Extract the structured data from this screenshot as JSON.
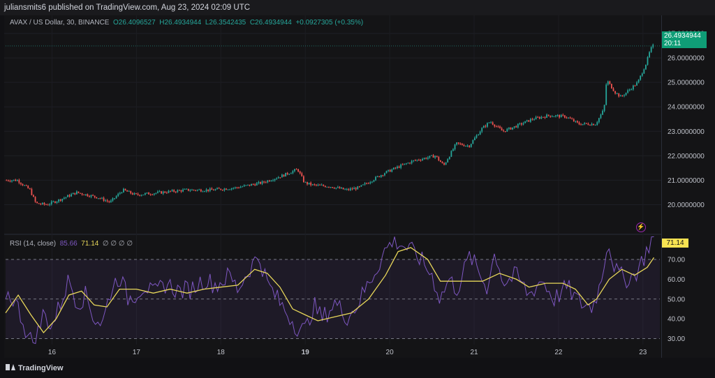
{
  "header": {
    "published": "juliansmits6 published on TradingView.com, Aug 23, 2024 02:09 UTC"
  },
  "legend": {
    "symbol": "AVAX / US Dollar, 30, BINANCE",
    "open": "O26.4096527",
    "high": "H26.4934944",
    "low": "L26.3542435",
    "close": "C26.4934944",
    "change": "+0.0927305 (+0.35%)"
  },
  "rsi_legend": {
    "label": "RSI (14, close)",
    "rsi_value": "85.66",
    "ma_value": "71.14",
    "extra": "∅ ∅ ∅ ∅"
  },
  "price_tag": {
    "price": "26.4934944",
    "countdown": "20:11"
  },
  "rsi_tag": "71.14",
  "branding": "TradingView",
  "colors": {
    "up": "#26a69a",
    "down": "#ef5350",
    "rsi": "#7e57c2",
    "rsi_ma": "#e8d75a",
    "price_tag": "#0f9d76",
    "rsi_tag": "#f7e352"
  },
  "icons": [
    "lightning-alert-icon",
    "tradingview-logo-icon"
  ],
  "price_axis": [
    "27.0000000",
    "26.0000000",
    "25.0000000",
    "24.0000000",
    "23.0000000",
    "22.0000000",
    "21.0000000",
    "20.0000000"
  ],
  "rsi_axis": [
    "70.00",
    "60.00",
    "50.00",
    "40.00",
    "30.00"
  ],
  "time_axis": [
    "16",
    "17",
    "18",
    "19",
    "20",
    "21",
    "22",
    "23"
  ],
  "chart_data": {
    "type": "candlestick",
    "symbol": "AVAX / US Dollar",
    "interval": "30",
    "price_ylim": [
      19.3,
      27.4
    ],
    "rsi_ylim": [
      27,
      82
    ],
    "rsi_bands": [
      70,
      50,
      30
    ],
    "x_range": [
      15.45,
      23.2
    ],
    "price_path": [
      [
        15.45,
        21.0
      ],
      [
        15.6,
        21.0
      ],
      [
        15.75,
        20.6
      ],
      [
        15.82,
        20.05
      ],
      [
        15.95,
        20.0
      ],
      [
        16.1,
        20.2
      ],
      [
        16.3,
        20.5
      ],
      [
        16.55,
        20.3
      ],
      [
        16.7,
        20.1
      ],
      [
        16.85,
        20.6
      ],
      [
        17.0,
        20.4
      ],
      [
        17.3,
        20.5
      ],
      [
        17.6,
        20.6
      ],
      [
        17.9,
        20.6
      ],
      [
        18.2,
        20.7
      ],
      [
        18.5,
        20.9
      ],
      [
        18.75,
        21.2
      ],
      [
        18.92,
        21.45
      ],
      [
        19.0,
        20.9
      ],
      [
        19.1,
        20.8
      ],
      [
        19.3,
        20.75
      ],
      [
        19.5,
        20.6
      ],
      [
        19.65,
        20.7
      ],
      [
        19.8,
        21.0
      ],
      [
        19.95,
        21.3
      ],
      [
        20.15,
        21.6
      ],
      [
        20.3,
        21.8
      ],
      [
        20.55,
        22.0
      ],
      [
        20.65,
        21.6
      ],
      [
        20.8,
        22.5
      ],
      [
        20.95,
        22.4
      ],
      [
        21.1,
        23.1
      ],
      [
        21.2,
        23.4
      ],
      [
        21.35,
        23.0
      ],
      [
        21.5,
        23.2
      ],
      [
        21.7,
        23.5
      ],
      [
        21.9,
        23.65
      ],
      [
        22.1,
        23.6
      ],
      [
        22.25,
        23.3
      ],
      [
        22.45,
        23.3
      ],
      [
        22.55,
        23.9
      ],
      [
        22.58,
        25.1
      ],
      [
        22.68,
        24.6
      ],
      [
        22.75,
        24.4
      ],
      [
        22.85,
        24.7
      ],
      [
        22.95,
        25.0
      ],
      [
        23.05,
        25.8
      ],
      [
        23.1,
        26.35
      ],
      [
        23.13,
        26.49
      ]
    ],
    "rsi_path": [
      [
        15.45,
        53
      ],
      [
        15.55,
        50
      ],
      [
        15.65,
        40
      ],
      [
        15.72,
        30
      ],
      [
        15.8,
        28
      ],
      [
        15.9,
        43
      ],
      [
        16.0,
        36
      ],
      [
        16.1,
        48
      ],
      [
        16.2,
        60
      ],
      [
        16.3,
        48
      ],
      [
        16.4,
        52
      ],
      [
        16.5,
        40
      ],
      [
        16.6,
        38
      ],
      [
        16.7,
        55
      ],
      [
        16.8,
        62
      ],
      [
        16.9,
        50
      ],
      [
        17.0,
        53
      ],
      [
        17.1,
        57
      ],
      [
        17.2,
        52
      ],
      [
        17.35,
        58
      ],
      [
        17.5,
        54
      ],
      [
        17.65,
        55
      ],
      [
        17.8,
        60
      ],
      [
        17.95,
        57
      ],
      [
        18.1,
        62
      ],
      [
        18.2,
        55
      ],
      [
        18.35,
        66
      ],
      [
        18.45,
        72
      ],
      [
        18.55,
        58
      ],
      [
        18.7,
        48
      ],
      [
        18.8,
        42
      ],
      [
        18.9,
        36
      ],
      [
        19.0,
        34
      ],
      [
        19.1,
        47
      ],
      [
        19.2,
        40
      ],
      [
        19.35,
        48
      ],
      [
        19.5,
        41
      ],
      [
        19.6,
        46
      ],
      [
        19.7,
        54
      ],
      [
        19.85,
        66
      ],
      [
        19.95,
        75
      ],
      [
        20.05,
        80
      ],
      [
        20.2,
        76
      ],
      [
        20.35,
        71
      ],
      [
        20.5,
        62
      ],
      [
        20.6,
        50
      ],
      [
        20.7,
        60
      ],
      [
        20.8,
        55
      ],
      [
        20.95,
        72
      ],
      [
        21.05,
        64
      ],
      [
        21.15,
        56
      ],
      [
        21.25,
        74
      ],
      [
        21.35,
        58
      ],
      [
        21.5,
        62
      ],
      [
        21.65,
        52
      ],
      [
        21.8,
        60
      ],
      [
        21.95,
        50
      ],
      [
        22.1,
        56
      ],
      [
        22.25,
        48
      ],
      [
        22.4,
        46
      ],
      [
        22.5,
        58
      ],
      [
        22.58,
        80
      ],
      [
        22.68,
        64
      ],
      [
        22.78,
        60
      ],
      [
        22.9,
        62
      ],
      [
        23.0,
        70
      ],
      [
        23.1,
        80
      ],
      [
        23.13,
        86
      ]
    ],
    "rsi_ma_path": [
      [
        15.45,
        43
      ],
      [
        15.6,
        52
      ],
      [
        15.75,
        42
      ],
      [
        15.9,
        33
      ],
      [
        16.05,
        40
      ],
      [
        16.2,
        52
      ],
      [
        16.35,
        54
      ],
      [
        16.5,
        47
      ],
      [
        16.65,
        46
      ],
      [
        16.8,
        55
      ],
      [
        17.0,
        55
      ],
      [
        17.2,
        53
      ],
      [
        17.4,
        55
      ],
      [
        17.6,
        53
      ],
      [
        17.8,
        55
      ],
      [
        18.0,
        56
      ],
      [
        18.2,
        57
      ],
      [
        18.4,
        65
      ],
      [
        18.55,
        63
      ],
      [
        18.7,
        56
      ],
      [
        18.85,
        45
      ],
      [
        19.0,
        42
      ],
      [
        19.15,
        39
      ],
      [
        19.35,
        41
      ],
      [
        19.55,
        43
      ],
      [
        19.75,
        50
      ],
      [
        19.95,
        62
      ],
      [
        20.1,
        74
      ],
      [
        20.25,
        76
      ],
      [
        20.45,
        70
      ],
      [
        20.6,
        59
      ],
      [
        20.75,
        59
      ],
      [
        20.9,
        59
      ],
      [
        21.1,
        59
      ],
      [
        21.3,
        63
      ],
      [
        21.5,
        60
      ],
      [
        21.65,
        56
      ],
      [
        21.85,
        58
      ],
      [
        22.05,
        58
      ],
      [
        22.2,
        55
      ],
      [
        22.35,
        47
      ],
      [
        22.45,
        50
      ],
      [
        22.6,
        60
      ],
      [
        22.75,
        65
      ],
      [
        22.9,
        62
      ],
      [
        23.05,
        66
      ],
      [
        23.13,
        71
      ]
    ]
  }
}
